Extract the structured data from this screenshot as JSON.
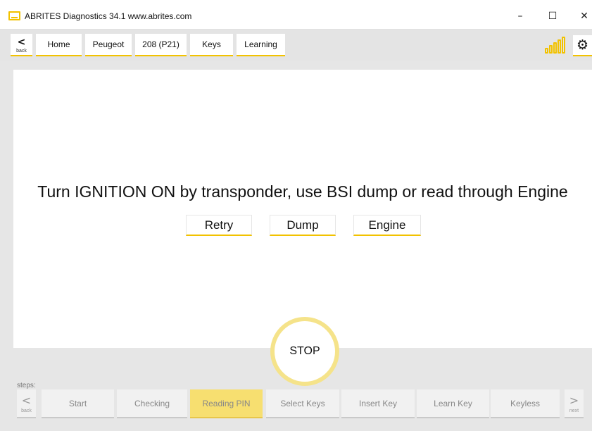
{
  "window": {
    "title": "ABRITES Diagnostics 34.1  www.abrites.com",
    "minimize": "–",
    "maximize": "☐",
    "close": "✕"
  },
  "nav": {
    "back_chevron": "<",
    "back_label": "back",
    "breadcrumbs": [
      "Home",
      "Peugeot",
      "208 (P21)",
      "Keys",
      "Learning"
    ],
    "settings_icon": "⚙"
  },
  "main": {
    "message": "Turn IGNITION ON by transponder, use BSI dump or read through Engine",
    "buttons": [
      "Retry",
      "Dump",
      "Engine"
    ]
  },
  "stop_label": "STOP",
  "steps": {
    "label": "steps:",
    "back_chevron": "<",
    "back_label": "back",
    "next_chevron": ">",
    "next_label": "next",
    "items": [
      "Start",
      "Checking",
      "Reading PIN",
      "Select Keys",
      "Insert Key",
      "Learn Key",
      "Keyless"
    ],
    "active_index": 2
  },
  "colors": {
    "accent": "#f2c200",
    "active_step": "#f7df70",
    "stop_ring": "#f5e38a"
  }
}
